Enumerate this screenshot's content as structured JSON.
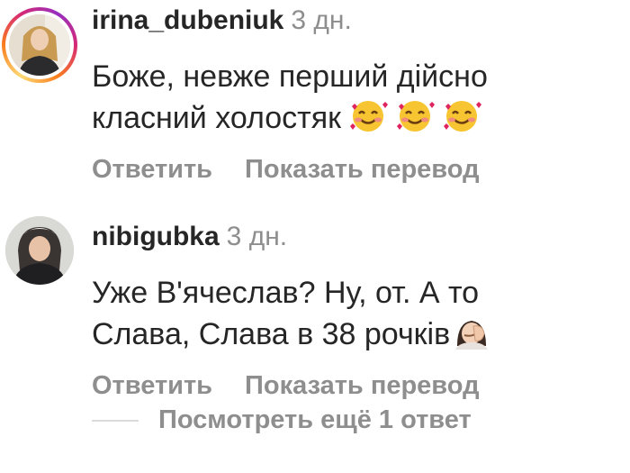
{
  "comments": [
    {
      "username": "irina_dubeniuk",
      "time": "3 дн.",
      "text_line1": "Боже, невже перший дійсно",
      "text_line2": "класний холостяк",
      "reply_label": "Ответить",
      "translate_label": "Показать перевод",
      "story_ring": true,
      "emoji": [
        "smiling-face-with-hearts",
        "smiling-face-with-hearts",
        "smiling-face-with-hearts"
      ]
    },
    {
      "username": "nibigubka",
      "time": "3 дн.",
      "text_line1": "Уже В'ячеслав? Ну, от. А то",
      "text_line2": "Слава, Слава в 38 рочків",
      "reply_label": "Ответить",
      "translate_label": "Показать перевод",
      "story_ring": false,
      "emoji": [
        "woman-facepalming"
      ]
    }
  ],
  "view_replies_label": "Посмотреть ещё 1 ответ",
  "colors": {
    "text": "#262626",
    "secondary": "#8e8e8e",
    "divider": "#dbdbdb"
  }
}
